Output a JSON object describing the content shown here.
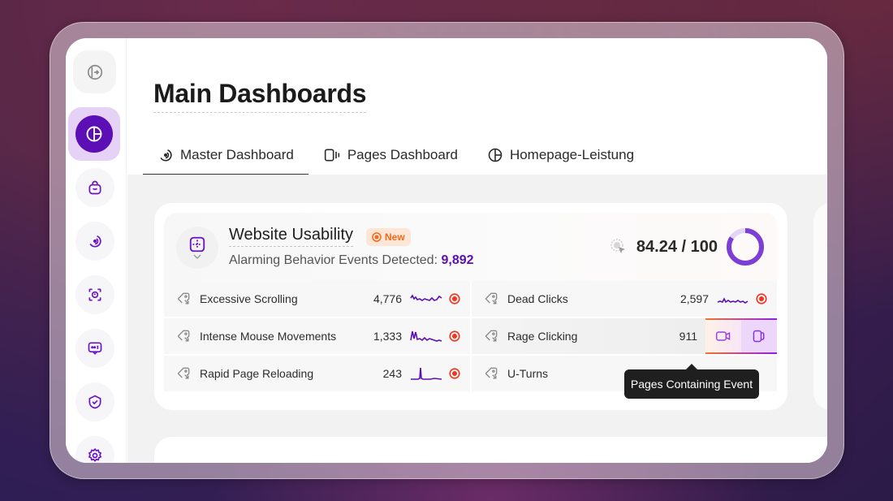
{
  "page": {
    "title": "Main Dashboards"
  },
  "sidebar": {
    "items": [
      {
        "name": "collapse",
        "icon": "expand-sidebar-icon"
      },
      {
        "name": "dashboards",
        "icon": "pie-chart-icon",
        "active": true
      },
      {
        "name": "shop",
        "icon": "shopping-bag-icon"
      },
      {
        "name": "heatmaps",
        "icon": "signal-icon"
      },
      {
        "name": "screen-capture",
        "icon": "focus-icon"
      },
      {
        "name": "feedback",
        "icon": "chat-icon"
      },
      {
        "name": "security",
        "icon": "shield-check-icon"
      },
      {
        "name": "settings",
        "icon": "gear-icon"
      }
    ]
  },
  "tabs": [
    {
      "label": "Master Dashboard",
      "icon": "signal-icon",
      "active": true
    },
    {
      "label": "Pages Dashboard",
      "icon": "pages-icon",
      "active": false
    },
    {
      "label": "Homepage-Leistung",
      "icon": "pie-chart-icon",
      "active": false
    }
  ],
  "usability": {
    "title": "Website Usability",
    "badge": "New",
    "subtitle": "Alarming Behavior Events Detected:",
    "events_count": "9,892",
    "score": "84.24 / 100",
    "score_fraction": 0.8424
  },
  "events": [
    {
      "label": "Excessive Scrolling",
      "value": "4,776",
      "alert": true
    },
    {
      "label": "Dead Clicks",
      "value": "2,597",
      "alert": true
    },
    {
      "label": "Intense Mouse Movements",
      "value": "1,333",
      "alert": true
    },
    {
      "label": "Rage Clicking",
      "value": "911",
      "alert": false,
      "hovered": true
    },
    {
      "label": "Rapid Page Reloading",
      "value": "243",
      "alert": true
    },
    {
      "label": "U-Turns",
      "value": "",
      "alert": false
    }
  ],
  "tooltip": {
    "text": "Pages Containing Event"
  },
  "colors": {
    "accent": "#5b0fb5",
    "alert": "#f0341f",
    "badge": "#f06a1a"
  }
}
